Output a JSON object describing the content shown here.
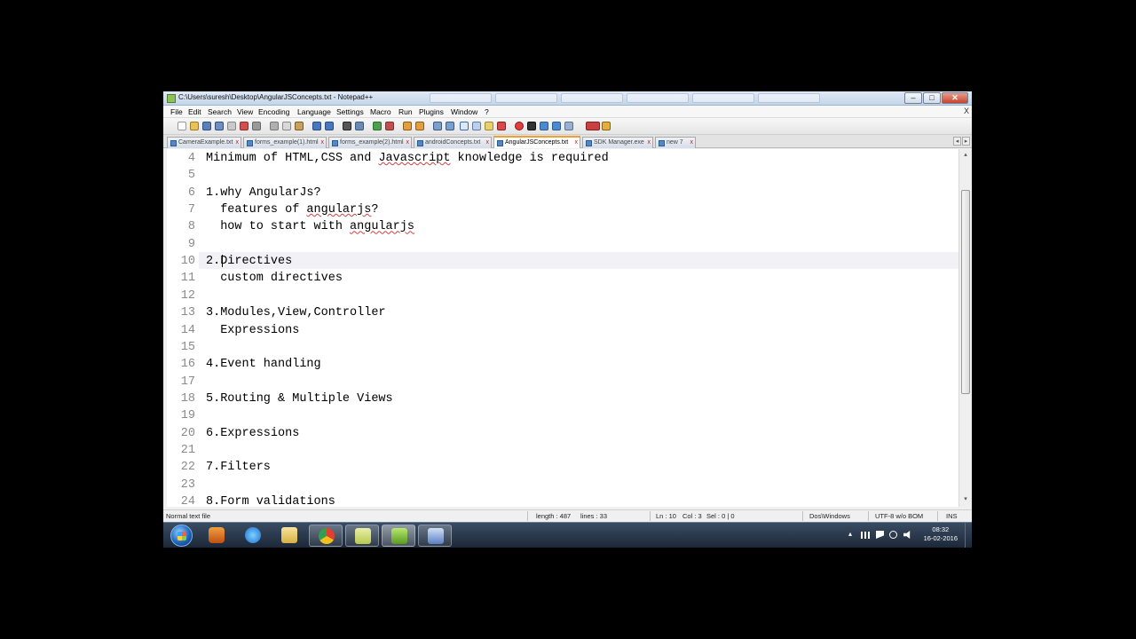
{
  "window": {
    "title": "C:\\Users\\suresh\\Desktop\\AngularJSConcepts.txt - Notepad++",
    "buttons": {
      "minimize": "–",
      "maximize": "□",
      "close": "✕"
    }
  },
  "menu": {
    "items": [
      "File",
      "Edit",
      "Search",
      "View",
      "Encoding",
      "Language",
      "Settings",
      "Macro",
      "Run",
      "Plugins",
      "Window",
      "?"
    ],
    "close_doc": "X"
  },
  "tabs": [
    {
      "label": "CameraExample.txt",
      "active": false
    },
    {
      "label": "forms_example(1).html",
      "active": false
    },
    {
      "label": "forms_example(2).html",
      "active": false
    },
    {
      "label": "androidConcepts.txt",
      "active": false
    },
    {
      "label": "AngularJSConcepts.txt",
      "active": true
    },
    {
      "label": "SDK Manager.exe",
      "active": false
    },
    {
      "label": "new 7",
      "active": false
    }
  ],
  "tab_close": "x",
  "tab_nav": {
    "prev": "◂",
    "next": "▸"
  },
  "editor": {
    "lines": [
      {
        "num": "4",
        "text": "Minimum of HTML,CSS and Javascript knowledge is required"
      },
      {
        "num": "5",
        "text": ""
      },
      {
        "num": "6",
        "text": "1.why AngularJs?"
      },
      {
        "num": "7",
        "text": "  features of angularjs?"
      },
      {
        "num": "8",
        "text": "  how to start with angularjs"
      },
      {
        "num": "9",
        "text": ""
      },
      {
        "num": "10",
        "text": "2.Directives"
      },
      {
        "num": "11",
        "text": "  custom directives"
      },
      {
        "num": "12",
        "text": ""
      },
      {
        "num": "13",
        "text": "3.Modules,View,Controller"
      },
      {
        "num": "14",
        "text": "  Expressions"
      },
      {
        "num": "15",
        "text": ""
      },
      {
        "num": "16",
        "text": "4.Event handling"
      },
      {
        "num": "17",
        "text": ""
      },
      {
        "num": "18",
        "text": "5.Routing & Multiple Views"
      },
      {
        "num": "19",
        "text": ""
      },
      {
        "num": "20",
        "text": "6.Expressions"
      },
      {
        "num": "21",
        "text": ""
      },
      {
        "num": "22",
        "text": "7.Filters"
      },
      {
        "num": "23",
        "text": ""
      },
      {
        "num": "24",
        "text": "8.Form validations"
      }
    ],
    "spellcheck_words": [
      "Javascript",
      "angularjs"
    ],
    "current_line": "10"
  },
  "scrollbar": {
    "up": "▴",
    "down": "▾"
  },
  "statusbar": {
    "file_type": "Normal text file",
    "length": "length : 487",
    "lines": "lines : 33",
    "ln": "Ln : 10",
    "col": "Col : 3",
    "sel": "Sel : 0 | 0",
    "eol": "Dos\\Windows",
    "encoding": "UTF-8 w/o BOM",
    "mode": "INS"
  },
  "taskbar": {
    "apps": [
      "start-menu",
      "media-player",
      "internet-explorer",
      "file-explorer",
      "chrome",
      "folder",
      "notepad-plus-plus",
      "remote-desktop"
    ],
    "tray_up": "▴",
    "clock_time": "08:32",
    "clock_date": "16-02-2016"
  }
}
